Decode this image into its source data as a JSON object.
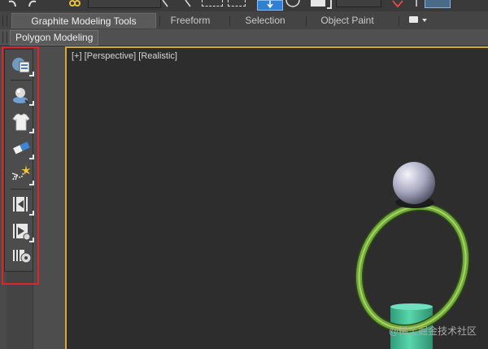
{
  "toolbar": {
    "icons": [
      "undo-icon",
      "redo-icon",
      "link-icon",
      "select-region-icon",
      "move-icon",
      "rotate-icon",
      "snap-icon",
      "color-swatch-icon",
      "render-icon"
    ]
  },
  "ribbon": {
    "tabs": [
      {
        "label": "Graphite Modeling Tools",
        "active": true
      },
      {
        "label": "Freeform",
        "active": false
      },
      {
        "label": "Selection",
        "active": false
      },
      {
        "label": "Object Paint",
        "active": false
      }
    ],
    "subtab": "Polygon Modeling"
  },
  "left_toolbar": {
    "tools": [
      {
        "name": "scene-explorer-icon",
        "has_flyout": true
      },
      {
        "name": "material-sphere-icon",
        "has_flyout": true
      },
      {
        "name": "cloth-shirt-icon",
        "has_flyout": true
      },
      {
        "name": "eraser-icon",
        "has_flyout": true
      },
      {
        "name": "particle-spark-icon",
        "has_flyout": true
      },
      {
        "name": "render-frame-back-icon",
        "has_flyout": true
      },
      {
        "name": "render-frame-forward-icon",
        "has_flyout": true
      },
      {
        "name": "render-settings-gear-icon",
        "has_flyout": false
      }
    ]
  },
  "viewport": {
    "label_plus": "[+]",
    "label_view": "[Perspective]",
    "label_shading": "[Realistic]"
  },
  "watermark": "@稀土掘金技术社区",
  "colors": {
    "viewport_border": "#d9a734",
    "highlight_box": "#e3232c",
    "ring": "#6fa83a",
    "cylinder": "#4fc29a"
  }
}
